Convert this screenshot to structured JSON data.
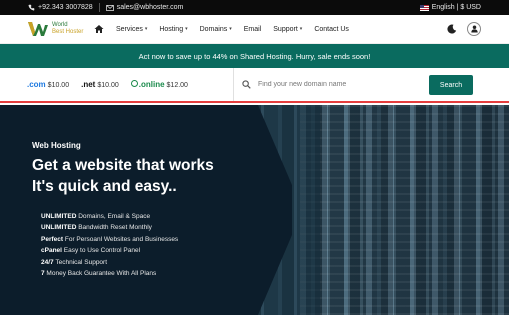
{
  "topbar": {
    "phone": "+92.343 3007828",
    "email": "sales@wbhoster.com",
    "locale": "English | $ USD"
  },
  "logo": {
    "line1": "World",
    "line2": "Best Hoster"
  },
  "nav": {
    "items": [
      {
        "label": "Services",
        "dropdown": true
      },
      {
        "label": "Hosting",
        "dropdown": true
      },
      {
        "label": "Domains",
        "dropdown": true
      },
      {
        "label": "Email",
        "dropdown": false
      },
      {
        "label": "Support",
        "dropdown": true
      },
      {
        "label": "Contact Us",
        "dropdown": false
      }
    ]
  },
  "promo": {
    "text": "Act now to save up to 44% on Shared Hosting. Hurry, sale ends soon!"
  },
  "domains": {
    "tlds": [
      {
        "name": ".com",
        "price": "$10.00"
      },
      {
        "name": ".net",
        "price": "$10.00"
      },
      {
        "name": ".online",
        "price": "$12.00"
      }
    ],
    "search_placeholder": "Find your new domain name",
    "search_button": "Search"
  },
  "hero": {
    "eyebrow": "Web Hosting",
    "title_line1": "Get a website that works",
    "title_line2": "It's quick and easy..",
    "features": [
      {
        "bold": "UNLIMITED",
        "text": " Domains, Email & Space"
      },
      {
        "bold": "UNLIMITED",
        "text": " Bandwidth Reset Monthly"
      },
      {
        "bold": "Perfect",
        "text": " For Persoanl Websites and Businesses"
      },
      {
        "bold": "cPanel",
        "text": " Easy to Use Control Panel"
      },
      {
        "bold": "24/7",
        "text": " Technical Support"
      },
      {
        "bold": "7",
        "text": " Money Back Guarantee With All Plans"
      }
    ]
  },
  "colors": {
    "brand_teal": "#0a6b5f",
    "accent_red": "#e53e3e",
    "topbar_bg": "#0b0b0b"
  }
}
